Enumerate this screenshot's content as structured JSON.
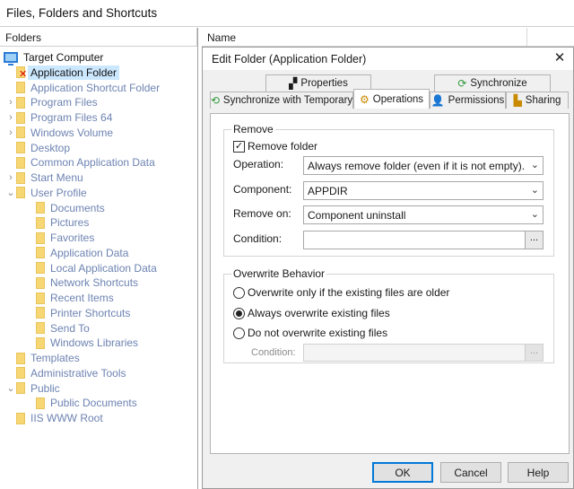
{
  "app": {
    "title": "Files, Folders and Shortcuts"
  },
  "folders_panel": {
    "header": "Folders",
    "items": [
      {
        "label": "Target Computer",
        "icon": "computer-icon",
        "state": "normal"
      },
      {
        "label": "Application Folder",
        "icon": "folder-remove-icon",
        "state": "selected"
      },
      {
        "label": "Application Shortcut Folder",
        "icon": "folder-icon",
        "state": "dim"
      },
      {
        "label": "Program Files",
        "icon": "folder-icon",
        "state": "dim",
        "expandable": true
      },
      {
        "label": "Program Files 64",
        "icon": "folder-icon",
        "state": "dim",
        "expandable": true
      },
      {
        "label": "Windows Volume",
        "icon": "folder-icon",
        "state": "dim",
        "expandable": true
      },
      {
        "label": "Desktop",
        "icon": "folder-icon",
        "state": "dim"
      },
      {
        "label": "Common Application Data",
        "icon": "folder-icon",
        "state": "dim"
      },
      {
        "label": "Start Menu",
        "icon": "folder-icon",
        "state": "dim",
        "expandable": true
      },
      {
        "label": "User Profile",
        "icon": "folder-icon",
        "state": "dim",
        "expanded": true
      },
      {
        "label": "Documents",
        "icon": "folder-icon",
        "state": "dim"
      },
      {
        "label": "Pictures",
        "icon": "folder-icon",
        "state": "dim"
      },
      {
        "label": "Favorites",
        "icon": "folder-icon",
        "state": "dim"
      },
      {
        "label": "Application Data",
        "icon": "folder-icon",
        "state": "dim"
      },
      {
        "label": "Local Application Data",
        "icon": "folder-icon",
        "state": "dim"
      },
      {
        "label": "Network Shortcuts",
        "icon": "folder-icon",
        "state": "dim"
      },
      {
        "label": "Recent Items",
        "icon": "folder-icon",
        "state": "dim"
      },
      {
        "label": "Printer Shortcuts",
        "icon": "folder-icon",
        "state": "dim"
      },
      {
        "label": "Send To",
        "icon": "folder-icon",
        "state": "dim"
      },
      {
        "label": "Windows Libraries",
        "icon": "folder-icon",
        "state": "dim"
      },
      {
        "label": "Templates",
        "icon": "folder-icon",
        "state": "dim"
      },
      {
        "label": "Administrative Tools",
        "icon": "folder-icon",
        "state": "dim"
      },
      {
        "label": "Public",
        "icon": "folder-icon",
        "state": "dim",
        "expanded": true
      },
      {
        "label": "Public Documents",
        "icon": "folder-icon",
        "state": "dim"
      },
      {
        "label": "IIS WWW Root",
        "icon": "folder-icon",
        "state": "dim"
      }
    ]
  },
  "list_header": {
    "name": "Name"
  },
  "dialog": {
    "title": "Edit Folder (Application Folder)",
    "tabs": {
      "properties": "Properties",
      "synchronize": "Synchronize",
      "sync_temp": "Synchronize with Temporary",
      "operations": "Operations",
      "permissions": "Permissions",
      "sharing": "Sharing"
    },
    "remove_group": {
      "title": "Remove",
      "remove_folder_label": "Remove folder",
      "remove_folder_checked": true,
      "operation_label": "Operation:",
      "operation_value": "Always remove folder (even if it is not empty).",
      "component_label": "Component:",
      "component_value": "APPDIR",
      "remove_on_label": "Remove on:",
      "remove_on_value": "Component uninstall",
      "condition_label": "Condition:",
      "condition_value": "",
      "browse_label": "..."
    },
    "overwrite_group": {
      "title": "Overwrite Behavior",
      "option_older": "Overwrite only if the existing files are older",
      "option_always": "Always overwrite existing files",
      "option_never": "Do not overwrite existing files",
      "selected": "always",
      "condition_label": "Condition:",
      "browse_label": "..."
    },
    "buttons": {
      "ok": "OK",
      "cancel": "Cancel",
      "help": "Help"
    }
  }
}
